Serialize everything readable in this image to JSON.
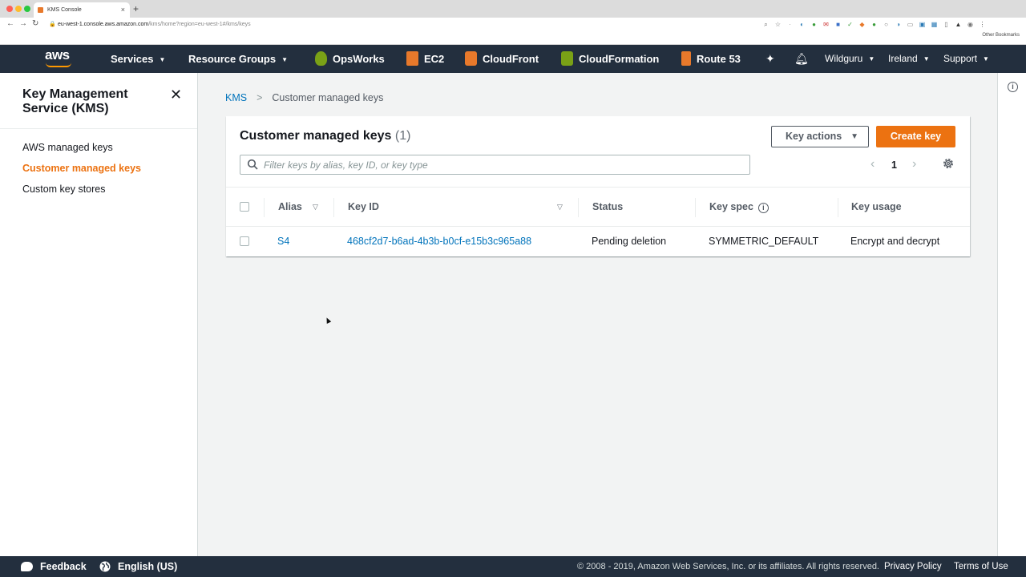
{
  "browser": {
    "tab_title": "KMS Console",
    "tab_close": "×",
    "new_tab": "+",
    "back": "←",
    "forward": "→",
    "reload": "↻",
    "url_host": "eu-west-1.console.aws.amazon.com",
    "url_path": "/kms/home?region=eu-west-1#/kms/keys",
    "bookmarks": "Other Bookmarks"
  },
  "aws_nav": {
    "logo": "aws",
    "services": "Services",
    "resource_groups": "Resource Groups",
    "shortcuts": [
      "OpsWorks",
      "EC2",
      "CloudFront",
      "CloudFormation",
      "Route 53"
    ],
    "account": "Wildguru",
    "region": "Ireland",
    "support": "Support"
  },
  "sidebar": {
    "title": "Key Management Service (KMS)",
    "close": "✕",
    "items": [
      {
        "label": "AWS managed keys",
        "active": false
      },
      {
        "label": "Customer managed keys",
        "active": true
      },
      {
        "label": "Custom key stores",
        "active": false
      }
    ]
  },
  "breadcrumb": {
    "root": "KMS",
    "current": "Customer managed keys"
  },
  "panel": {
    "title": "Customer managed keys",
    "count": "(1)",
    "key_actions": "Key actions",
    "create_key": "Create key",
    "filter_placeholder": "Filter keys by alias, key ID, or key type",
    "page": "1",
    "prev": "‹",
    "next": "›"
  },
  "table": {
    "columns": [
      "Alias",
      "Key ID",
      "Status",
      "Key spec",
      "Key usage"
    ],
    "rows": [
      {
        "alias": "S4",
        "key_id": "468cf2d7-b6ad-4b3b-b0cf-e15b3c965a88",
        "status": "Pending deletion",
        "key_spec": "SYMMETRIC_DEFAULT",
        "key_usage": "Encrypt and decrypt"
      }
    ]
  },
  "footer": {
    "feedback": "Feedback",
    "language": "English (US)",
    "copyright": "© 2008 - 2019, Amazon Web Services, Inc. or its affiliates. All rights reserved.",
    "privacy": "Privacy Policy",
    "terms": "Terms of Use"
  },
  "colors": {
    "nav_bg": "#232f3e",
    "accent_orange": "#ec7211",
    "link_blue": "#0073bb"
  }
}
